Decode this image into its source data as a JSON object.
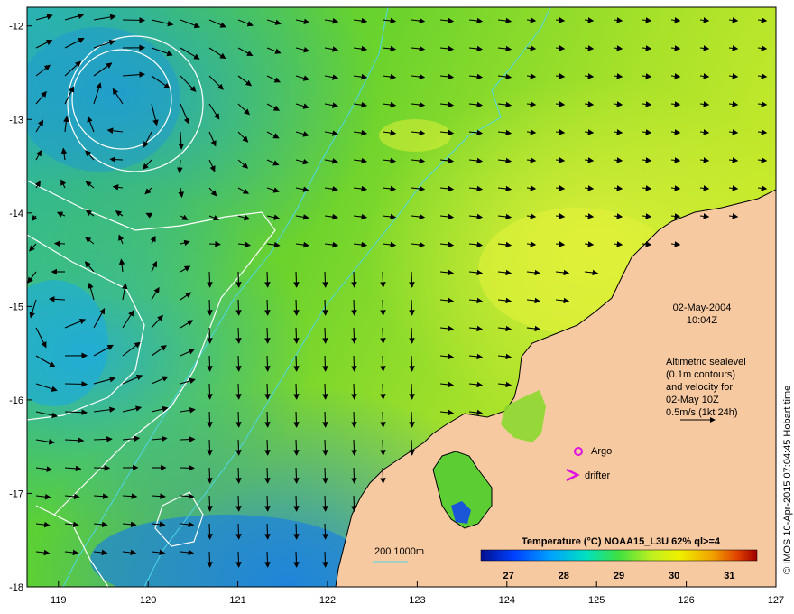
{
  "map": {
    "date": "02-May-2004",
    "time": "10:04Z",
    "sealevel_note": [
      "Altimetric sealevel",
      "(0.1m contours)",
      "and velocity for",
      "02-May 10Z",
      "0.5m/s (1kt 24h)"
    ],
    "argo_label": "Argo",
    "drifter_label": "drifter",
    "depth_label": "200  1000m",
    "colorbar": {
      "title": "Temperature (°C) NOAA15_L3U 62% ql>=4",
      "ticks": [
        "27",
        "28",
        "29",
        "30",
        "31"
      ],
      "range": [
        26.5,
        31.5
      ]
    },
    "credit": "© IMOS 10-Apr-2015 07:04:45 Hobart time",
    "lon_ticks": [
      "119",
      "120",
      "121",
      "122",
      "123",
      "124",
      "125",
      "126",
      "127"
    ],
    "lat_ticks": [
      "-12",
      "-13",
      "-14",
      "-15",
      "-16",
      "-17",
      "-18"
    ],
    "lon_range": [
      118.65,
      127.0
    ],
    "lat_range": [
      -18.0,
      -11.8
    ],
    "colors": {
      "land": "#f7c9a0",
      "ocean_warm": "#b7e52a",
      "ocean_mid": "#5ccd33",
      "ocean_cool": "#1fb3c8",
      "contour": "#ffffff",
      "bathymetry": "#4fd6e6",
      "marker": "#e010e0"
    }
  }
}
